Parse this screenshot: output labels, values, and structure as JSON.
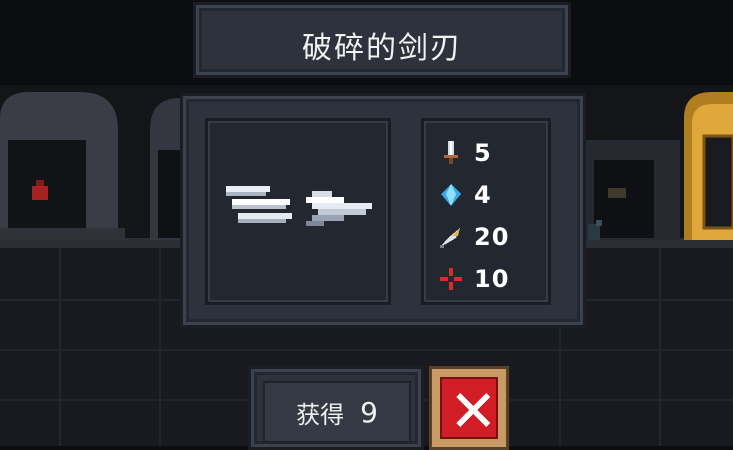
{
  "item": {
    "name": "破碎的剑刃",
    "icon": "broken-blade-icon"
  },
  "stats": [
    {
      "icon": "sword-damage-icon",
      "value": "5"
    },
    {
      "icon": "energy-crystal-icon",
      "value": "4"
    },
    {
      "icon": "feather-crit-icon",
      "value": "20"
    },
    {
      "icon": "crosshair-accuracy-icon",
      "value": "10"
    }
  ],
  "price": {
    "label": "获得",
    "value": "9"
  },
  "close": {
    "icon": "close-x-icon"
  },
  "colors": {
    "panel": "#2d323c",
    "slot": "#232730",
    "close_red": "#d11e26",
    "close_frame": "#c89a64"
  }
}
